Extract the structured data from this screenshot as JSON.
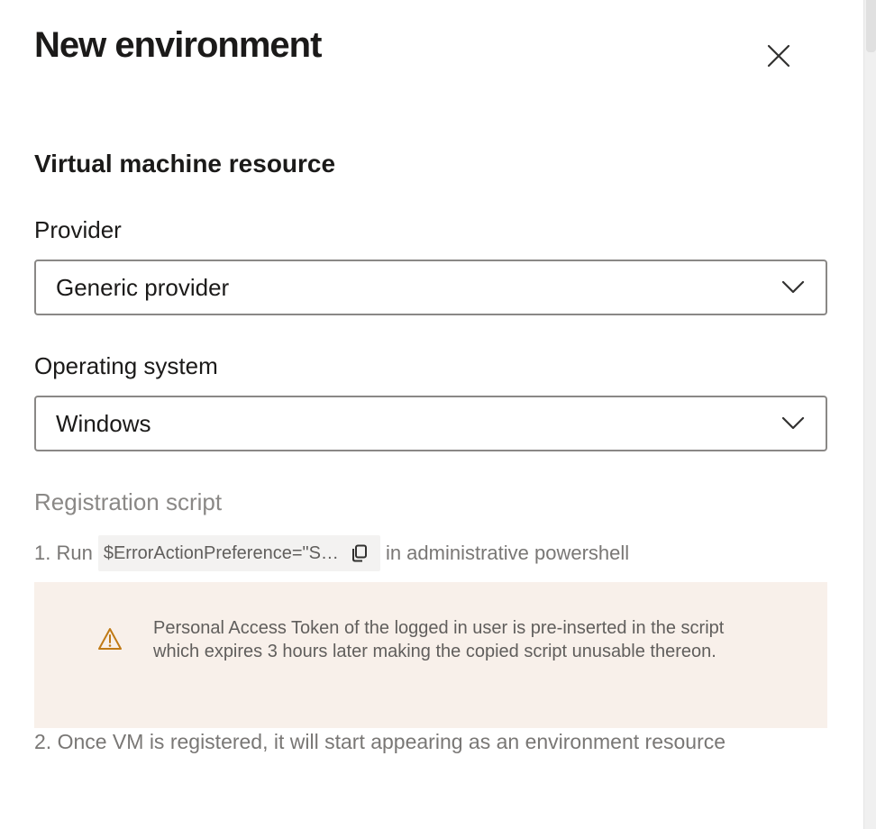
{
  "panel": {
    "title": "New environment",
    "close_label": "Close"
  },
  "section": {
    "title": "Virtual machine resource"
  },
  "provider": {
    "label": "Provider",
    "value": "Generic provider"
  },
  "os": {
    "label": "Operating system",
    "value": "Windows"
  },
  "registration": {
    "heading": "Registration script",
    "step1_prefix": "1. Run",
    "step1_code": "$ErrorActionPreference=\"S…",
    "step1_suffix": "in administrative powershell",
    "warning_text": "Personal Access Token of the logged in user is pre-inserted in the script which expires 3 hours later making the copied script unusable thereon.",
    "step2": "2. Once VM is registered, it will start appearing as an environment resource"
  },
  "colors": {
    "warning_bg": "#f8f0ea",
    "warning_icon": "#c07a16",
    "muted_text": "#797775"
  },
  "icons": {
    "close": "close-icon",
    "chevron": "chevron-down-icon",
    "copy": "copy-icon",
    "warning": "warning-icon"
  }
}
